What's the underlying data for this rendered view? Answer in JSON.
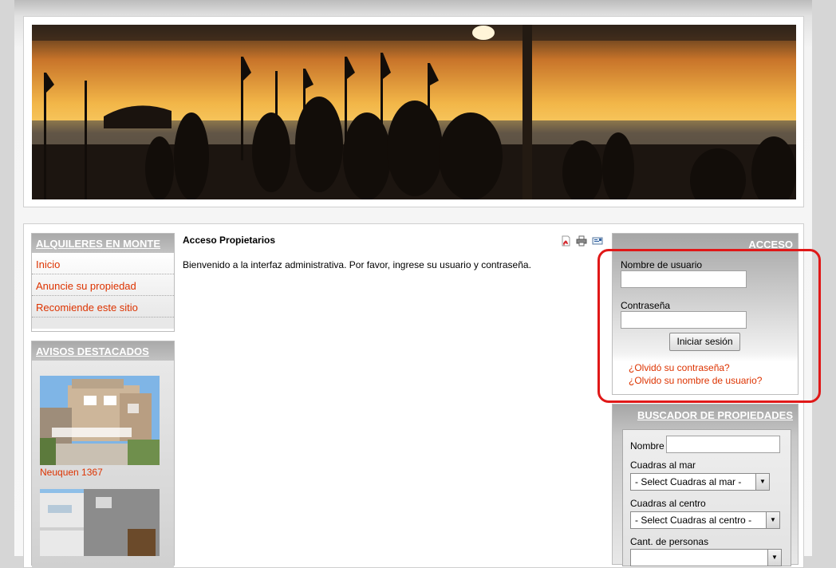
{
  "banner": {
    "alt": "sunset beach scene"
  },
  "left_menu": {
    "title": "ALQUILERES EN MONTE",
    "items": [
      {
        "label": "Inicio"
      },
      {
        "label": "Anuncie su propiedad"
      },
      {
        "label": "Recomiende este sitio"
      }
    ]
  },
  "avisos": {
    "title": "AVISOS DESTACADOS",
    "items": [
      {
        "caption": "Neuquen 1367"
      }
    ]
  },
  "main": {
    "title": "Acceso Propietarios",
    "text": "Bienvenido a la interfaz administrativa. Por favor, ingrese su usuario y contraseña.",
    "icons": [
      "pdf-icon",
      "print-icon",
      "email-icon"
    ]
  },
  "login": {
    "title": "ACCESO",
    "username_label": "Nombre de usuario",
    "password_label": "Contraseña",
    "username_value": "",
    "password_value": "",
    "submit_label": "Iniciar sesión",
    "forgot_password": "¿Olvidó su contraseña?",
    "forgot_username": "¿Olvido su nombre de usuario?"
  },
  "search": {
    "title": "BUSCADOR DE PROPIEDADES",
    "name_label": "Nombre",
    "name_value": "",
    "mar_label": "Cuadras al mar",
    "mar_selected": "- Select Cuadras al mar -",
    "centro_label": "Cuadras al centro",
    "centro_selected": "- Select Cuadras al centro -",
    "personas_label": "Cant. de personas"
  },
  "colors": {
    "link": "#dd3300",
    "highlight": "#e01818",
    "module_title": "#a9a9a9"
  }
}
